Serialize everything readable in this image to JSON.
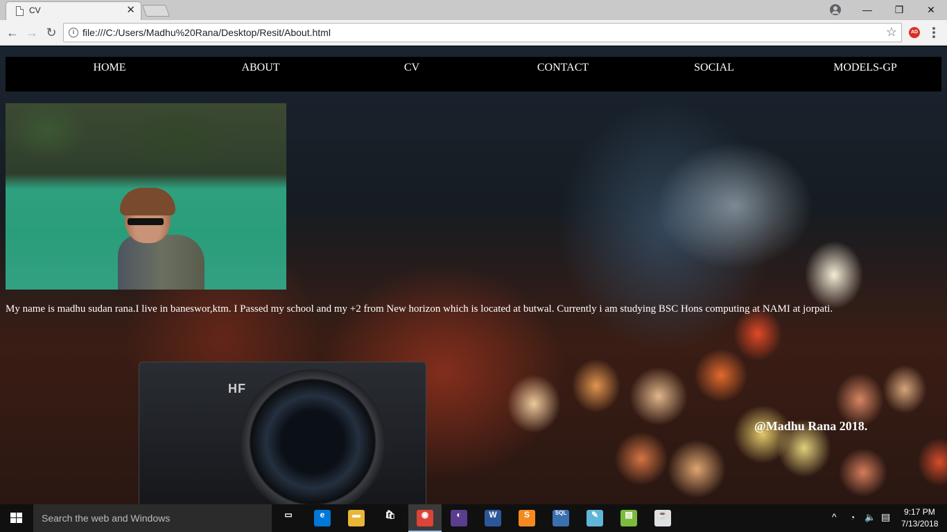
{
  "browser": {
    "tab_title": "CV",
    "tab_close": "✕",
    "url": "file:///C:/Users/Madhu%20Rana/Desktop/Resit/About.html",
    "window_controls": {
      "minimize": "—",
      "restore": "❐",
      "close": "✕"
    },
    "nav": {
      "back": "←",
      "forward": "→",
      "reload": "↻"
    },
    "star": "☆",
    "extension_badge": "AD"
  },
  "site": {
    "nav": [
      {
        "label": "HOME"
      },
      {
        "label": "ABOUT"
      },
      {
        "label": "CV"
      },
      {
        "label": "CONTACT"
      },
      {
        "label": "SOCIAL"
      },
      {
        "label": "MODELS-GP"
      }
    ],
    "camera_brand": "HF",
    "bio": "My name is madhu sudan rana.I live in baneswor,ktm. I Passed my school and my +2 from New horizon which is located at butwal. Currently i am studying BSC Hons computing at NAMI at jorpati.",
    "footer": "@Madhu Rana 2018."
  },
  "taskbar": {
    "search_placeholder": "Search the web and Windows",
    "apps": [
      {
        "icon": "task-view-icon",
        "glyph": "▭",
        "color": "#101010"
      },
      {
        "icon": "edge-icon",
        "glyph": "e",
        "color": "#0078d7"
      },
      {
        "icon": "file-explorer-icon",
        "glyph": "▬",
        "color": "#e8b739"
      },
      {
        "icon": "store-icon",
        "glyph": "🛍",
        "color": "#101010"
      },
      {
        "icon": "chrome-icon",
        "glyph": "◉",
        "color": "#db4437"
      },
      {
        "icon": "eclipse-icon",
        "glyph": "◐",
        "color": "#5b3d8f"
      },
      {
        "icon": "word-icon",
        "glyph": "W",
        "color": "#2b579a"
      },
      {
        "icon": "sublime-icon",
        "glyph": "S",
        "color": "#f48a1f"
      },
      {
        "icon": "sql-icon",
        "glyph": "SQL",
        "color": "#3a6fb0"
      },
      {
        "icon": "notepad-icon",
        "glyph": "✎",
        "color": "#5fb6d9"
      },
      {
        "icon": "chart-app-icon",
        "glyph": "▤",
        "color": "#7cba3d"
      },
      {
        "icon": "java-icon",
        "glyph": "☕",
        "color": "#e0e0e0"
      }
    ],
    "tray": {
      "chevron": "^",
      "time": "9:17 PM",
      "date": "7/13/2018"
    }
  }
}
